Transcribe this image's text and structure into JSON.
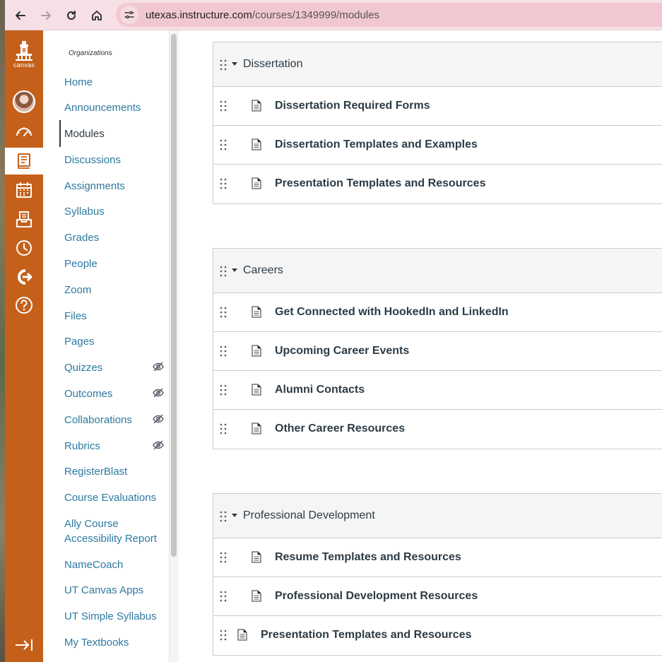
{
  "browser": {
    "url_host": "utexas.instructure.com",
    "url_path": "/courses/1349999/modules"
  },
  "global_nav": {
    "logo_text": "canvas",
    "brand_color": "#c4601a"
  },
  "course_nav": {
    "subtitle": "Organizations",
    "items": [
      {
        "label": "Home"
      },
      {
        "label": "Announcements"
      },
      {
        "label": "Modules"
      },
      {
        "label": "Discussions"
      },
      {
        "label": "Assignments"
      },
      {
        "label": "Syllabus"
      },
      {
        "label": "Grades"
      },
      {
        "label": "People"
      },
      {
        "label": "Zoom"
      },
      {
        "label": "Files"
      },
      {
        "label": "Pages"
      },
      {
        "label": "Quizzes"
      },
      {
        "label": "Outcomes"
      },
      {
        "label": "Collaborations"
      },
      {
        "label": "Rubrics"
      },
      {
        "label": "RegisterBlast"
      },
      {
        "label": "Course Evaluations"
      },
      {
        "label": "Ally Course Accessibility Report"
      },
      {
        "label": "NameCoach"
      },
      {
        "label": "UT Canvas Apps"
      },
      {
        "label": "UT Simple Syllabus"
      },
      {
        "label": "My Textbooks"
      }
    ]
  },
  "modules": [
    {
      "title": "Dissertation",
      "items": [
        {
          "title": "Dissertation Required Forms"
        },
        {
          "title": "Dissertation Templates and Examples"
        },
        {
          "title": "Presentation Templates and Resources"
        }
      ]
    },
    {
      "title": "Careers",
      "items": [
        {
          "title": "Get Connected with HookedIn and LinkedIn"
        },
        {
          "title": "Upcoming Career Events"
        },
        {
          "title": "Alumni Contacts"
        },
        {
          "title": "Other Career Resources"
        }
      ]
    },
    {
      "title": "Professional Development",
      "items": [
        {
          "title": "Resume Templates and Resources"
        },
        {
          "title": "Professional Development Resources"
        },
        {
          "title": "Presentation Templates and Resources"
        }
      ]
    }
  ]
}
